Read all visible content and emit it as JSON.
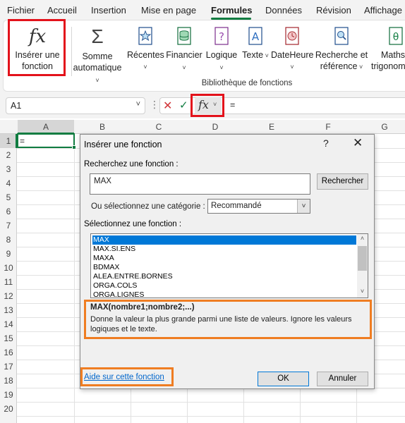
{
  "menu": {
    "tabs": [
      {
        "label": "Fichier"
      },
      {
        "label": "Accueil"
      },
      {
        "label": "Insertion"
      },
      {
        "label": "Mise en page"
      },
      {
        "label": "Formules"
      },
      {
        "label": "Données"
      },
      {
        "label": "Révision"
      },
      {
        "label": "Affichage"
      }
    ],
    "active_tab": "Formules",
    "accent_color": "#107c41"
  },
  "ribbon": {
    "insert_function": {
      "line1": "Insérer une",
      "line2": "fonction",
      "icon": "fx-icon"
    },
    "autosum": {
      "line1": "Somme",
      "line2": "automatique",
      "icon": "sigma-icon"
    },
    "buttons": [
      {
        "label": "Récentes",
        "icon": "star-icon"
      },
      {
        "label": "Financier",
        "icon": "database-icon"
      },
      {
        "label": "Logique",
        "icon": "question-icon"
      },
      {
        "label": "Texte",
        "icon": "text-a-icon"
      },
      {
        "label": "DateHeure",
        "icon": "clock-icon"
      },
      {
        "label": "Recherche et",
        "label2": "référence",
        "icon": "lookup-icon"
      },
      {
        "label": "Maths",
        "label2": "trigonom",
        "icon": "theta-icon"
      }
    ],
    "group_label": "Bibliothèque de fonctions"
  },
  "formula_bar": {
    "name_box": "A1",
    "formula": "=",
    "fx_label": "fx"
  },
  "sheet": {
    "columns": [
      "A",
      "B",
      "C",
      "D",
      "E",
      "F",
      "G"
    ],
    "rows": [
      "1",
      "2",
      "3",
      "4",
      "5",
      "6",
      "7",
      "8",
      "9",
      "10",
      "11",
      "12",
      "13",
      "14",
      "15",
      "16",
      "17",
      "18",
      "19",
      "20"
    ],
    "a1_value": "="
  },
  "dialog": {
    "title": "Insérer une fonction",
    "help": "?",
    "close": "✕",
    "search_label": "Recherchez une fonction :",
    "search_value": "MAX",
    "search_button": "Rechercher",
    "category_label": "Ou sélectionnez une catégorie :",
    "category_value": "Recommandé",
    "select_label": "Sélectionnez une fonction :",
    "functions": [
      "MAX",
      "MAX.SI.ENS",
      "MAXA",
      "BDMAX",
      "ALEA.ENTRE.BORNES",
      "ORGA.COLS",
      "ORGA.LIGNES"
    ],
    "selected_function": "MAX",
    "signature": "MAX(nombre1;nombre2;...)",
    "description": "Donne la valeur la plus grande parmi une liste de valeurs. Ignore les valeurs logiques et le texte.",
    "help_link": "Aide sur cette fonction",
    "ok": "OK",
    "cancel": "Annuler"
  },
  "highlight_colors": {
    "red": "#e3121b",
    "orange": "#ef7d22"
  }
}
